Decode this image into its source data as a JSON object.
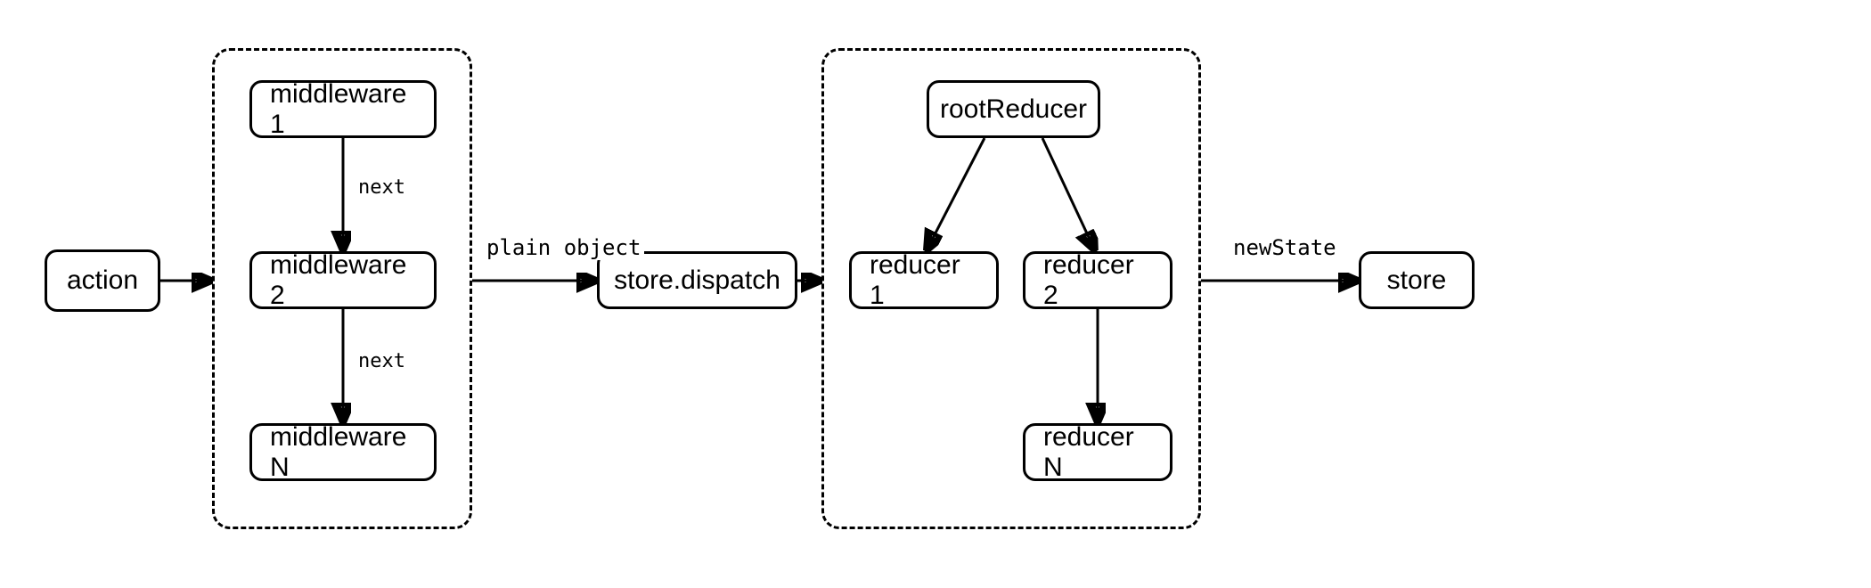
{
  "nodes": {
    "action": "action",
    "middleware1": "middleware 1",
    "middleware2": "middleware 2",
    "middlewareN": "middleware N",
    "dispatch": "store.dispatch",
    "rootReducer": "rootReducer",
    "reducer1": "reducer 1",
    "reducer2": "reducer 2",
    "reducerN": "reducer N",
    "store": "store"
  },
  "edgeLabels": {
    "next1": "next",
    "next2": "next",
    "plainObject": "plain object",
    "newState": "newState"
  }
}
